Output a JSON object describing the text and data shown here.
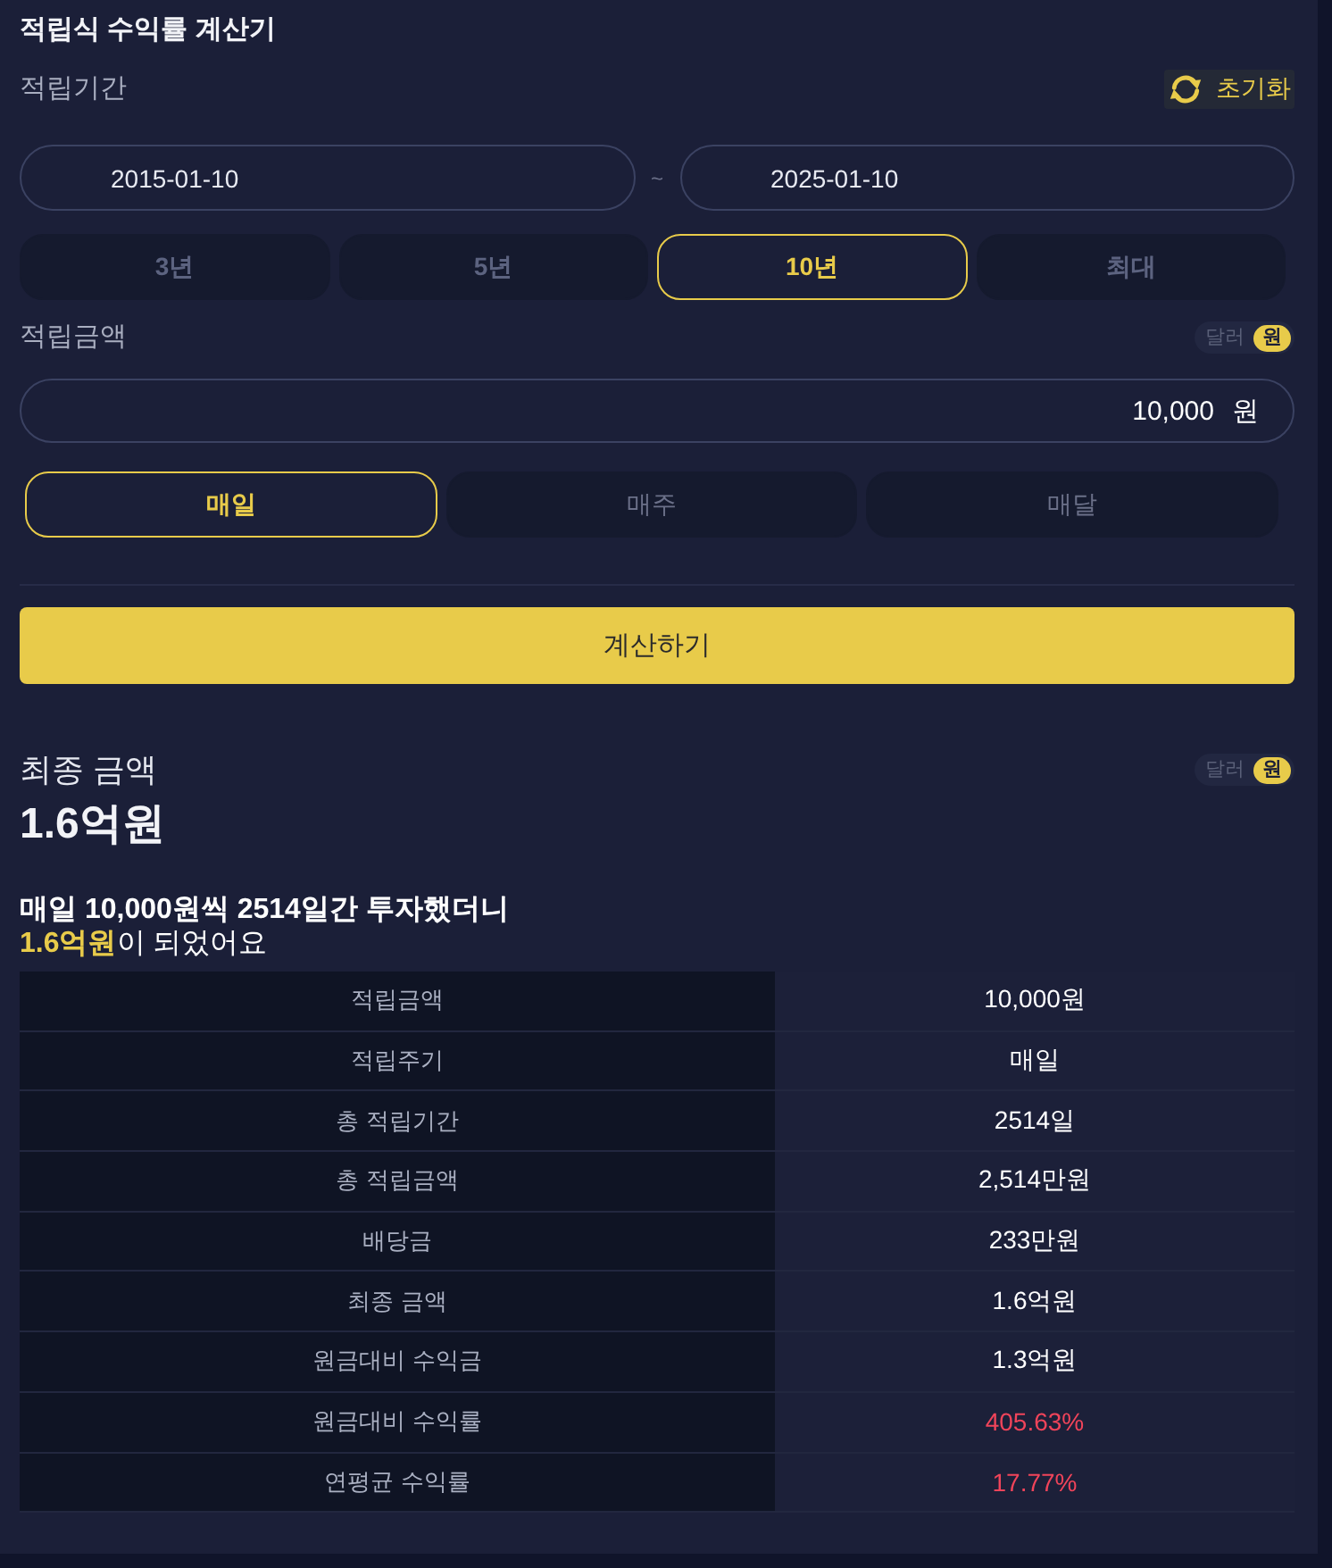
{
  "title": "적립식 수익률 계산기",
  "period": {
    "label": "적립기간",
    "reset_button": "초기화",
    "start_date": "2015-01-10",
    "separator": "~",
    "end_date": "2025-01-10",
    "presets": [
      {
        "label": "3년",
        "selected": false
      },
      {
        "label": "5년",
        "selected": false
      },
      {
        "label": "10년",
        "selected": true
      },
      {
        "label": "최대",
        "selected": false
      }
    ]
  },
  "amount": {
    "label": "적립금액",
    "currency_toggle": [
      {
        "label": "달러",
        "selected": false
      },
      {
        "label": "원",
        "selected": true
      }
    ],
    "value": "10,000",
    "unit": "원",
    "frequencies": [
      {
        "label": "매일",
        "selected": true
      },
      {
        "label": "매주",
        "selected": false
      },
      {
        "label": "매달",
        "selected": false
      }
    ]
  },
  "calculate_button": "계산하기",
  "result": {
    "label": "최종 금액",
    "currency_toggle": [
      {
        "label": "달러",
        "selected": false
      },
      {
        "label": "원",
        "selected": true
      }
    ],
    "total": "1.6억원",
    "summary_lines": [
      "매일 10,000원씩 2514일간 투자했더니",
      "**1.6억원**이 되었어요"
    ]
  },
  "table": {
    "rows": [
      {
        "label": "적립금액",
        "value": "10,000원",
        "kind": "amount"
      },
      {
        "label": "적립주기",
        "value": "매일",
        "kind": "amount"
      },
      {
        "label": "총 적립기간",
        "value": "2514일",
        "kind": "amount"
      },
      {
        "label": "총 적립금액",
        "value": "2,514만원",
        "kind": "amount"
      },
      {
        "label": "배당금",
        "value": "233만원",
        "kind": "amount"
      },
      {
        "label": "최종 금액",
        "value": "1.6억원",
        "kind": "amount"
      },
      {
        "label": "원금대비 수익금",
        "value": "1.3억원",
        "kind": "amount"
      },
      {
        "label": "원금대비 수익률",
        "value": "405.63%",
        "kind": "rate"
      },
      {
        "label": "연평균 수익률",
        "value": "17.77%",
        "kind": "rate"
      }
    ]
  }
}
